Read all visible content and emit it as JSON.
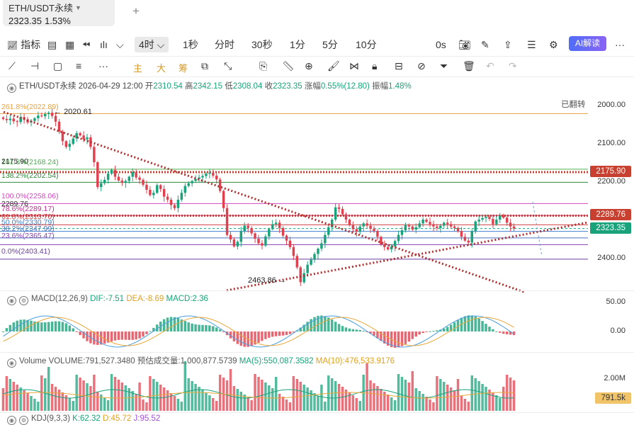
{
  "tab": {
    "symbol": "ETH/USDT永续",
    "price": "2323.35",
    "change": "1.53%"
  },
  "toolbar": {
    "indicator_label": "指标",
    "selected_interval": "4时",
    "intervals": [
      "1秒",
      "分时",
      "30秒",
      "1分",
      "5分",
      "10分"
    ],
    "countdown": "0s",
    "ai_label": "AI解读"
  },
  "drawing_tools": {
    "zhu": "主",
    "da": "大",
    "chou": "筹"
  },
  "info": {
    "symbol": "ETH/USDT永续",
    "datetime": "2026-04-29 12:00",
    "open_label": "开",
    "open": "2310.54",
    "high_label": "高",
    "high": "2342.15",
    "low_label": "低",
    "low": "2308.04",
    "close_label": "收",
    "close": "2323.35",
    "change_label": "涨幅",
    "change": "0.55%(12.80)",
    "amp_label": "振幅",
    "amp": "1.48%"
  },
  "flip_label": "已翻转",
  "price_axis": {
    "ticks": [
      "2000.00",
      "2100.00",
      "2200.00",
      "2400.00"
    ],
    "badges": [
      {
        "value": "2175.90",
        "color": "#c8402f"
      },
      {
        "value": "2289.76",
        "color": "#c8402f"
      },
      {
        "value": "2323.35",
        "color": "#1aa37a"
      }
    ]
  },
  "annotations": {
    "high_marker": "2020.61",
    "low_marker": "2463.86",
    "level_2175": "2175.90",
    "level_2289": "2289.76"
  },
  "fib_levels": [
    {
      "label": "261.8%(2022.89)",
      "color": "#e8a040"
    },
    {
      "label": "161.8%(2168.24)",
      "color": "#4caf50"
    },
    {
      "label": "138.2%(2202.54)",
      "color": "#2e8b3e"
    },
    {
      "label": "100.0%(2258.06)",
      "color": "#d048c0"
    },
    {
      "label": "78.6%(2289.17)",
      "color": "#c03090"
    },
    {
      "label": "61.8%(2313.70)",
      "color": "#d04040"
    },
    {
      "label": "50.0%(2330.79)",
      "color": "#4080d0"
    },
    {
      "label": "38.2%(2347.99)",
      "color": "#4a70c0"
    },
    {
      "label": "23.6%(2365.47)",
      "color": "#8a40b0"
    },
    {
      "label": "0.0%(2403.41)",
      "color": "#6a3fa0"
    }
  ],
  "macd": {
    "title": "MACD(12,26,9)",
    "dif": "DIF:-7.51",
    "dea": "DEA:-8.69",
    "macd": "MACD:2.36",
    "ticks": [
      "50.00",
      "0.00"
    ]
  },
  "volume": {
    "title": "Volume",
    "volume": "VOLUME:791,527.3480",
    "est_label": "预估成交量:1,000,877.5739",
    "ma5": "MA(5):550,087.3582",
    "ma10": "MA(10):476,533.9176",
    "tick": "2.00M",
    "badge": "791.5k"
  },
  "kdj": {
    "title": "KDJ(9,3,3)",
    "k": "K:62.32",
    "d": "D:45.72",
    "j": "J:95.52"
  },
  "chart_data": {
    "type": "candlestick",
    "title": "ETH/USDT永续 4时",
    "y_axis": {
      "inverted": true,
      "range": [
        1990,
        2420
      ],
      "ticks": [
        2000,
        2100,
        2200,
        2400
      ]
    },
    "close_series": [
      2037,
      2040,
      2036,
      2043,
      2045,
      2032,
      2038,
      2046,
      2042,
      2035,
      2028,
      2030,
      2024,
      2020.6,
      2029,
      2044,
      2070,
      2095,
      2110,
      2102,
      2088,
      2074,
      2080,
      2090,
      2085,
      2110,
      2150,
      2215,
      2205,
      2196,
      2180,
      2170,
      2188,
      2198,
      2204,
      2199,
      2188,
      2176,
      2190,
      2196,
      2209,
      2222,
      2236,
      2230,
      2210,
      2220,
      2240,
      2248,
      2262,
      2270,
      2248,
      2230,
      2212,
      2205,
      2199,
      2194,
      2190,
      2186,
      2180,
      2178,
      2185,
      2195,
      2225,
      2270,
      2340,
      2352,
      2370,
      2358,
      2330,
      2316,
      2322,
      2336,
      2350,
      2362,
      2368,
      2344,
      2325,
      2312,
      2308,
      2322,
      2342,
      2355,
      2372,
      2395,
      2425,
      2463.86,
      2440,
      2418,
      2405,
      2390,
      2376,
      2362,
      2340,
      2320,
      2300,
      2268,
      2272,
      2286,
      2300,
      2315,
      2325,
      2332,
      2318,
      2310,
      2316,
      2324,
      2330,
      2345,
      2365,
      2372,
      2378,
      2370,
      2356,
      2340,
      2328,
      2315,
      2318,
      2326,
      2320,
      2310,
      2300,
      2306,
      2312,
      2318,
      2322,
      2316,
      2308,
      2312,
      2318,
      2322,
      2330,
      2345,
      2355,
      2360,
      2330,
      2305,
      2300,
      2296,
      2293,
      2298,
      2312,
      2300,
      2289.76,
      2295,
      2308,
      2318,
      2323.35
    ]
  }
}
